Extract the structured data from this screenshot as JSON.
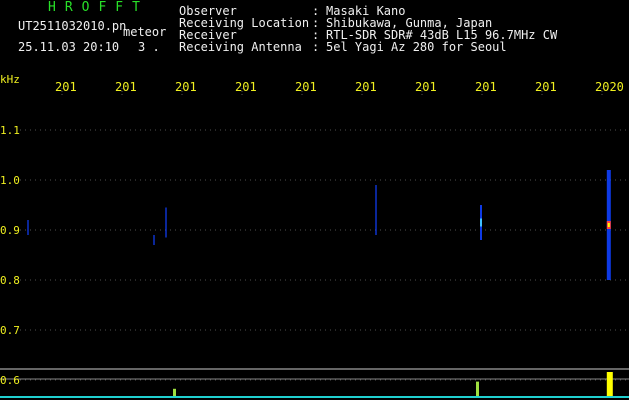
{
  "header": {
    "title": "HROFFT",
    "file_name": "UT2511032010.pn",
    "mode": "meteor",
    "datetime": "25.11.03 20:10",
    "count": "3 ."
  },
  "info": {
    "observer_label": "Observer",
    "observer_value": "Masaki Kano",
    "location_label": "Receiving Location",
    "location_value": "Shibukawa, Gunma, Japan",
    "receiver_label": "Receiver",
    "receiver_value": "RTL-SDR SDR# 43dB L15 96.7MHz CW",
    "antenna_label": "Receiving Antenna",
    "antenna_value": "5el Yagi Az 280 for Seoul",
    "colon": ":"
  },
  "colors": {
    "background": "#000000",
    "title": "#28e028",
    "text": "#f0f0f0",
    "axis": "#f0f020",
    "grid": "#505050",
    "signal": "#1040ff",
    "signal_hot": "#ffff00",
    "meter": "#20d0d0"
  },
  "chart_data": {
    "type": "heatmap",
    "title": "",
    "ylabel": "kHz",
    "xlabel": "",
    "ylim": [
      0.6,
      1.2
    ],
    "yticks": [
      {
        "value": 1.1,
        "label": "1.1"
      },
      {
        "value": 1.0,
        "label": "1.0"
      },
      {
        "value": 0.9,
        "label": "0.9"
      },
      {
        "value": 0.8,
        "label": "0.8"
      },
      {
        "value": 0.7,
        "label": "0.7"
      },
      {
        "value": 0.6,
        "label": "0.6"
      }
    ],
    "x_minute_labels": [
      "201",
      "201",
      "201",
      "201",
      "201",
      "201",
      "201",
      "201",
      "201",
      "2020"
    ],
    "x_range": [
      2010,
      2020
    ],
    "events": [
      {
        "time": 2010.3,
        "freq_center": 0.905,
        "freq_span": 0.03,
        "intensity": "low"
      },
      {
        "time": 2012.6,
        "freq_center": 0.915,
        "freq_span": 0.06,
        "intensity": "low"
      },
      {
        "time": 2012.4,
        "freq_center": 0.88,
        "freq_span": 0.02,
        "intensity": "low"
      },
      {
        "time": 2016.1,
        "freq_center": 0.94,
        "freq_span": 0.1,
        "intensity": "low"
      },
      {
        "time": 2017.85,
        "freq_center": 0.915,
        "freq_span": 0.07,
        "intensity": "medium"
      },
      {
        "time": 2019.98,
        "freq_center": 0.91,
        "freq_span": 0.22,
        "intensity": "high"
      }
    ],
    "meter_spikes": [
      {
        "time": 2012.75,
        "level": 0.3
      },
      {
        "time": 2017.8,
        "level": 0.6
      },
      {
        "time": 2019.98,
        "level": 1.0
      }
    ]
  }
}
